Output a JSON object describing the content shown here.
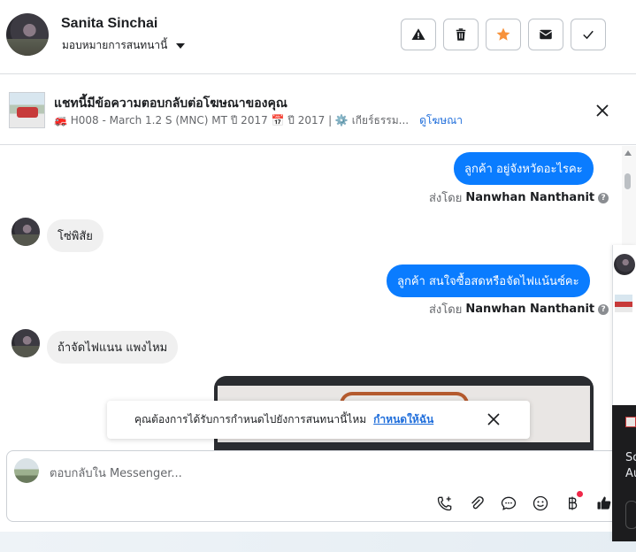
{
  "header": {
    "contact_name": "Sanita Sinchai",
    "assign_label": "มอบหมายการสนทนานี้",
    "actions": [
      {
        "icon": "warning-icon"
      },
      {
        "icon": "trash-icon"
      },
      {
        "icon": "star-icon",
        "color": "#f7923b"
      },
      {
        "icon": "mail-icon"
      },
      {
        "icon": "check-icon"
      }
    ]
  },
  "ad": {
    "title": "แชทนี้มีข้อความตอบกลับต่อโฆษณาของคุณ",
    "subtitle": "🚒 H008 - March 1.2 S (MNC) MT ปี 2017 📅 ปี 2017 | ⚙️ เกียร์ธรรม...",
    "link": "ดูโฆษณา"
  },
  "messages": [
    {
      "direction": "out",
      "text": "ลูกค้า อยู่จังหวัดอะไรคะ",
      "sent_by_prefix": "ส่งโดย",
      "sent_by": "Nanwhan Nanthanit"
    },
    {
      "direction": "in",
      "text": "โซ่พิสัย"
    },
    {
      "direction": "out",
      "text": "ลูกค้า สนใจซื้อสดหรือจัดไฟแน้นซ์คะ",
      "sent_by_prefix": "ส่งโดย",
      "sent_by": "Nanwhan Nanthanit"
    },
    {
      "direction": "in",
      "text": "ถ้าจัดไฟแนน แพงไหม"
    }
  ],
  "notify": {
    "text": "คุณต้องการได้รับการกำหนดไปยังการสนทนานี้ไหม",
    "link": "กำหนดให้ฉัน"
  },
  "composer": {
    "placeholder": "ตอบกลับใน Messenger...",
    "tools": [
      "phone-plus-icon",
      "attachment-icon",
      "chat-bubble-icon",
      "emoji-icon",
      "baht-icon",
      "thumbs-up-icon"
    ]
  },
  "side_panel": {
    "text_line1": "So",
    "text_line2": "Au"
  },
  "colors": {
    "accent": "#0a7cff",
    "link": "#216fdb",
    "star": "#f7923b"
  }
}
